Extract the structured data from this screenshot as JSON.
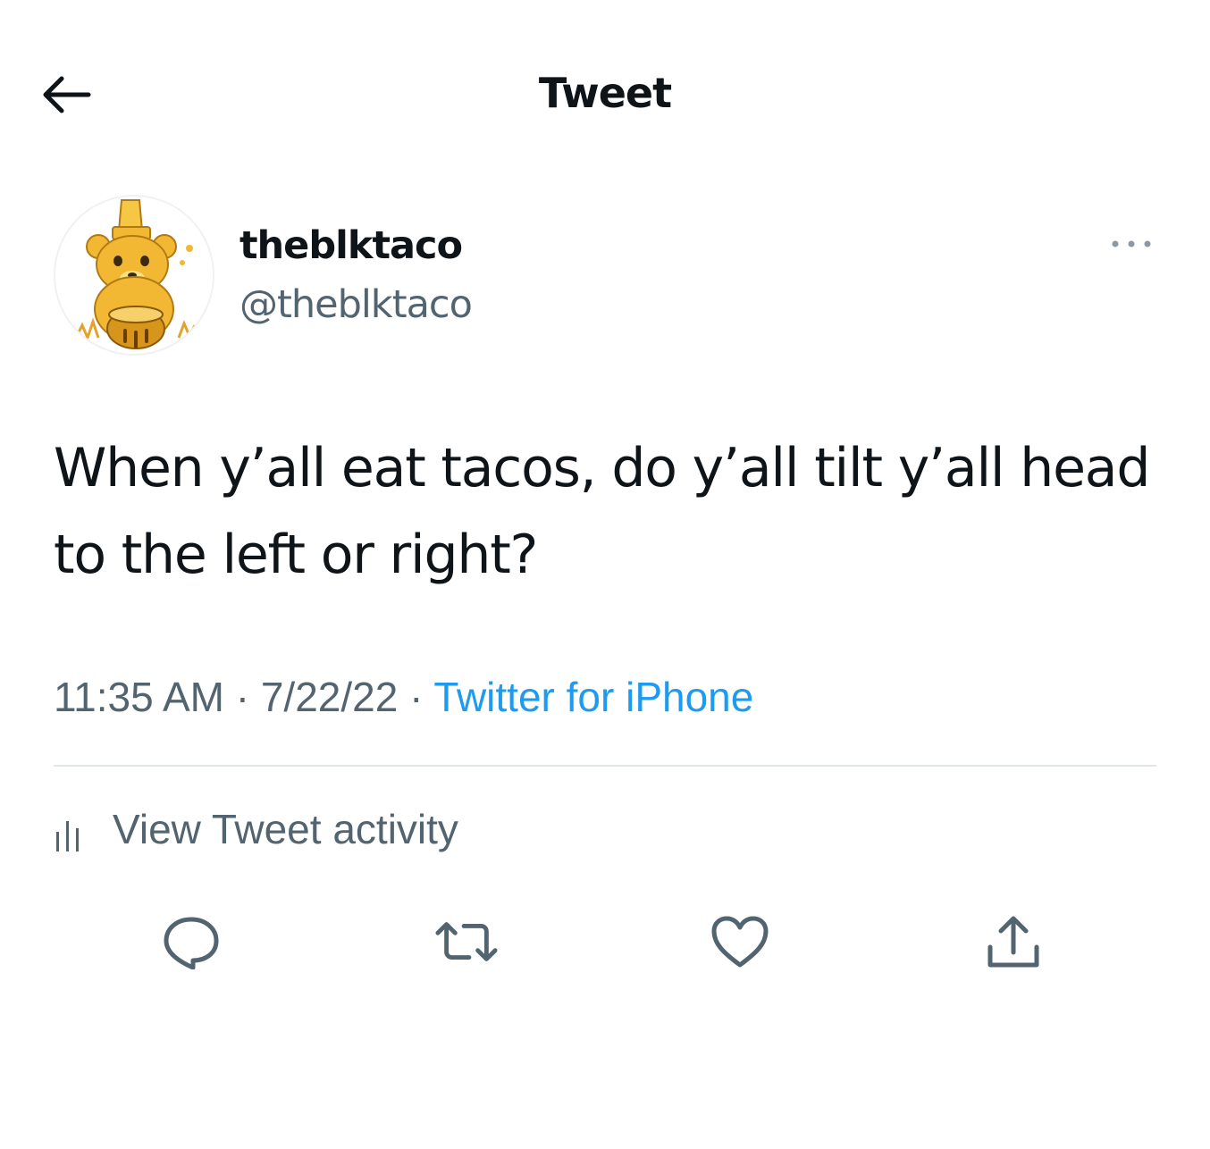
{
  "header": {
    "back_icon": "arrow-left-icon",
    "title": "Tweet"
  },
  "author": {
    "avatar_icon": "bear-honey-pot-avatar",
    "display_name": "theblktaco",
    "handle": "@theblktaco",
    "more_icon": "ellipsis-icon"
  },
  "tweet": {
    "text": "When y’all eat tacos, do y’all tilt y’all head to the left or right?",
    "time": "11:35 AM",
    "separator": "·",
    "date": "7/22/22",
    "source": "Twitter for iPhone"
  },
  "activity": {
    "icon": "bar-chart-icon",
    "label": "View Tweet activity"
  },
  "actions": [
    {
      "name": "reply",
      "icon": "reply-bubble-icon"
    },
    {
      "name": "retweet",
      "icon": "retweet-icon"
    },
    {
      "name": "like",
      "icon": "heart-icon"
    },
    {
      "name": "share",
      "icon": "share-icon"
    }
  ],
  "colors": {
    "text_primary": "#0f1419",
    "text_secondary": "#536471",
    "link": "#1d9bf0",
    "divider": "#e1e6ea",
    "avatar_gold": "#f2b733"
  }
}
